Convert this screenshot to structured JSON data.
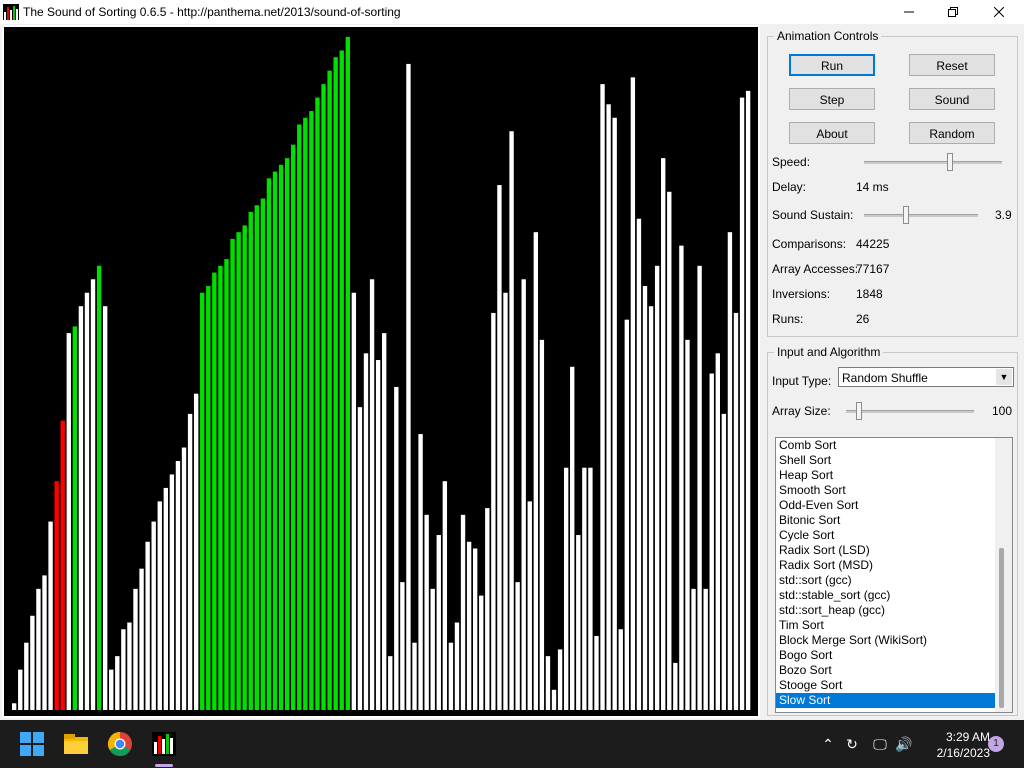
{
  "window": {
    "title": "The Sound of Sorting 0.6.5 - http://panthema.net/2013/sound-of-sorting"
  },
  "controls": {
    "group_title": "Animation Controls",
    "buttons": [
      "Run",
      "Reset",
      "Step",
      "Sound",
      "About",
      "Random"
    ],
    "speed_label": "Speed:",
    "speed_level": 0.62,
    "delay_label": "Delay:",
    "delay_value": "14 ms",
    "sustain_label": "Sound Sustain:",
    "sustain_value": "3.9",
    "sustain_level": 0.37,
    "stats": [
      {
        "label": "Comparisons:",
        "value": "44225"
      },
      {
        "label": "Array Accesses:",
        "value": "77167"
      },
      {
        "label": "Inversions:",
        "value": "1848"
      },
      {
        "label": "Runs:",
        "value": "26"
      }
    ]
  },
  "input": {
    "group_title": "Input and Algorithm",
    "input_type_label": "Input Type:",
    "input_type_value": "Random Shuffle",
    "array_size_label": "Array Size:",
    "array_size_value": "100",
    "array_size_level": 0.1,
    "algorithms": [
      "Comb Sort",
      "Shell Sort",
      "Heap Sort",
      "Smooth Sort",
      "Odd-Even Sort",
      "Bitonic Sort",
      "Cycle Sort",
      "Radix Sort (LSD)",
      "Radix Sort (MSD)",
      "std::sort (gcc)",
      "std::stable_sort (gcc)",
      "std::sort_heap (gcc)",
      "Tim Sort",
      "Block Merge Sort (WikiSort)",
      "Bogo Sort",
      "Bozo Sort",
      "Stooge Sort",
      "Slow Sort"
    ],
    "selected_algorithm": "Slow Sort"
  },
  "array": {
    "max_value": 100,
    "values": [
      1,
      6,
      10,
      14,
      18,
      20,
      28,
      34,
      43,
      56,
      57,
      60,
      62,
      64,
      66,
      60,
      6,
      8,
      12,
      13,
      18,
      21,
      25,
      28,
      31,
      33,
      35,
      37,
      39,
      44,
      47,
      62,
      63,
      65,
      66,
      67,
      70,
      71,
      72,
      74,
      75,
      76,
      79,
      80,
      81,
      82,
      84,
      87,
      88,
      89,
      91,
      93,
      95,
      97,
      98,
      100,
      62,
      45,
      53,
      64,
      52,
      56,
      8,
      48,
      19,
      96,
      10,
      41,
      29,
      18,
      26,
      34,
      10,
      13,
      29,
      25,
      24,
      17,
      30,
      59,
      78,
      62,
      86,
      19,
      64,
      31,
      71,
      55,
      8,
      3,
      9,
      36,
      51,
      26,
      36,
      36,
      11,
      93,
      90,
      88,
      12,
      58,
      94,
      73,
      63,
      60,
      66,
      82,
      77,
      7,
      69,
      55,
      18,
      66,
      18,
      50,
      53,
      44,
      71,
      59,
      91,
      92
    ],
    "colors": [
      "w",
      "w",
      "w",
      "w",
      "w",
      "w",
      "w",
      "r",
      "r",
      "w",
      "g",
      "w",
      "w",
      "w",
      "g",
      "w",
      "w",
      "w",
      "w",
      "w",
      "w",
      "w",
      "w",
      "w",
      "w",
      "w",
      "w",
      "w",
      "w",
      "w",
      "w",
      "g",
      "g",
      "g",
      "g",
      "g",
      "g",
      "g",
      "g",
      "g",
      "g",
      "g",
      "g",
      "g",
      "g",
      "g",
      "g",
      "g",
      "g",
      "g",
      "g",
      "g",
      "g",
      "g",
      "g",
      "g",
      "w",
      "w",
      "w",
      "w",
      "w",
      "w",
      "w",
      "w",
      "w",
      "w",
      "w",
      "w",
      "w",
      "w",
      "w",
      "w",
      "w",
      "w",
      "w",
      "w",
      "w",
      "w",
      "w",
      "w",
      "w",
      "w",
      "w",
      "w",
      "w",
      "w",
      "w",
      "w",
      "w",
      "w",
      "w",
      "w",
      "w",
      "w",
      "w",
      "w",
      "w",
      "w",
      "w",
      "w",
      "w",
      "w",
      "w",
      "w",
      "w",
      "w",
      "w",
      "w",
      "w",
      "w",
      "w",
      "w",
      "w",
      "w",
      "w",
      "w",
      "w",
      "w",
      "w",
      "w",
      "w",
      "w"
    ],
    "palette": {
      "w": "#ffffff",
      "r": "#ff0000",
      "g": "#00e000"
    }
  },
  "taskbar": {
    "time": "3:29 AM",
    "date": "2/16/2023",
    "notification_count": "1",
    "icons": [
      "windows-start-icon",
      "file-explorer-icon",
      "chrome-icon",
      "sound-of-sorting-app-icon"
    ]
  }
}
